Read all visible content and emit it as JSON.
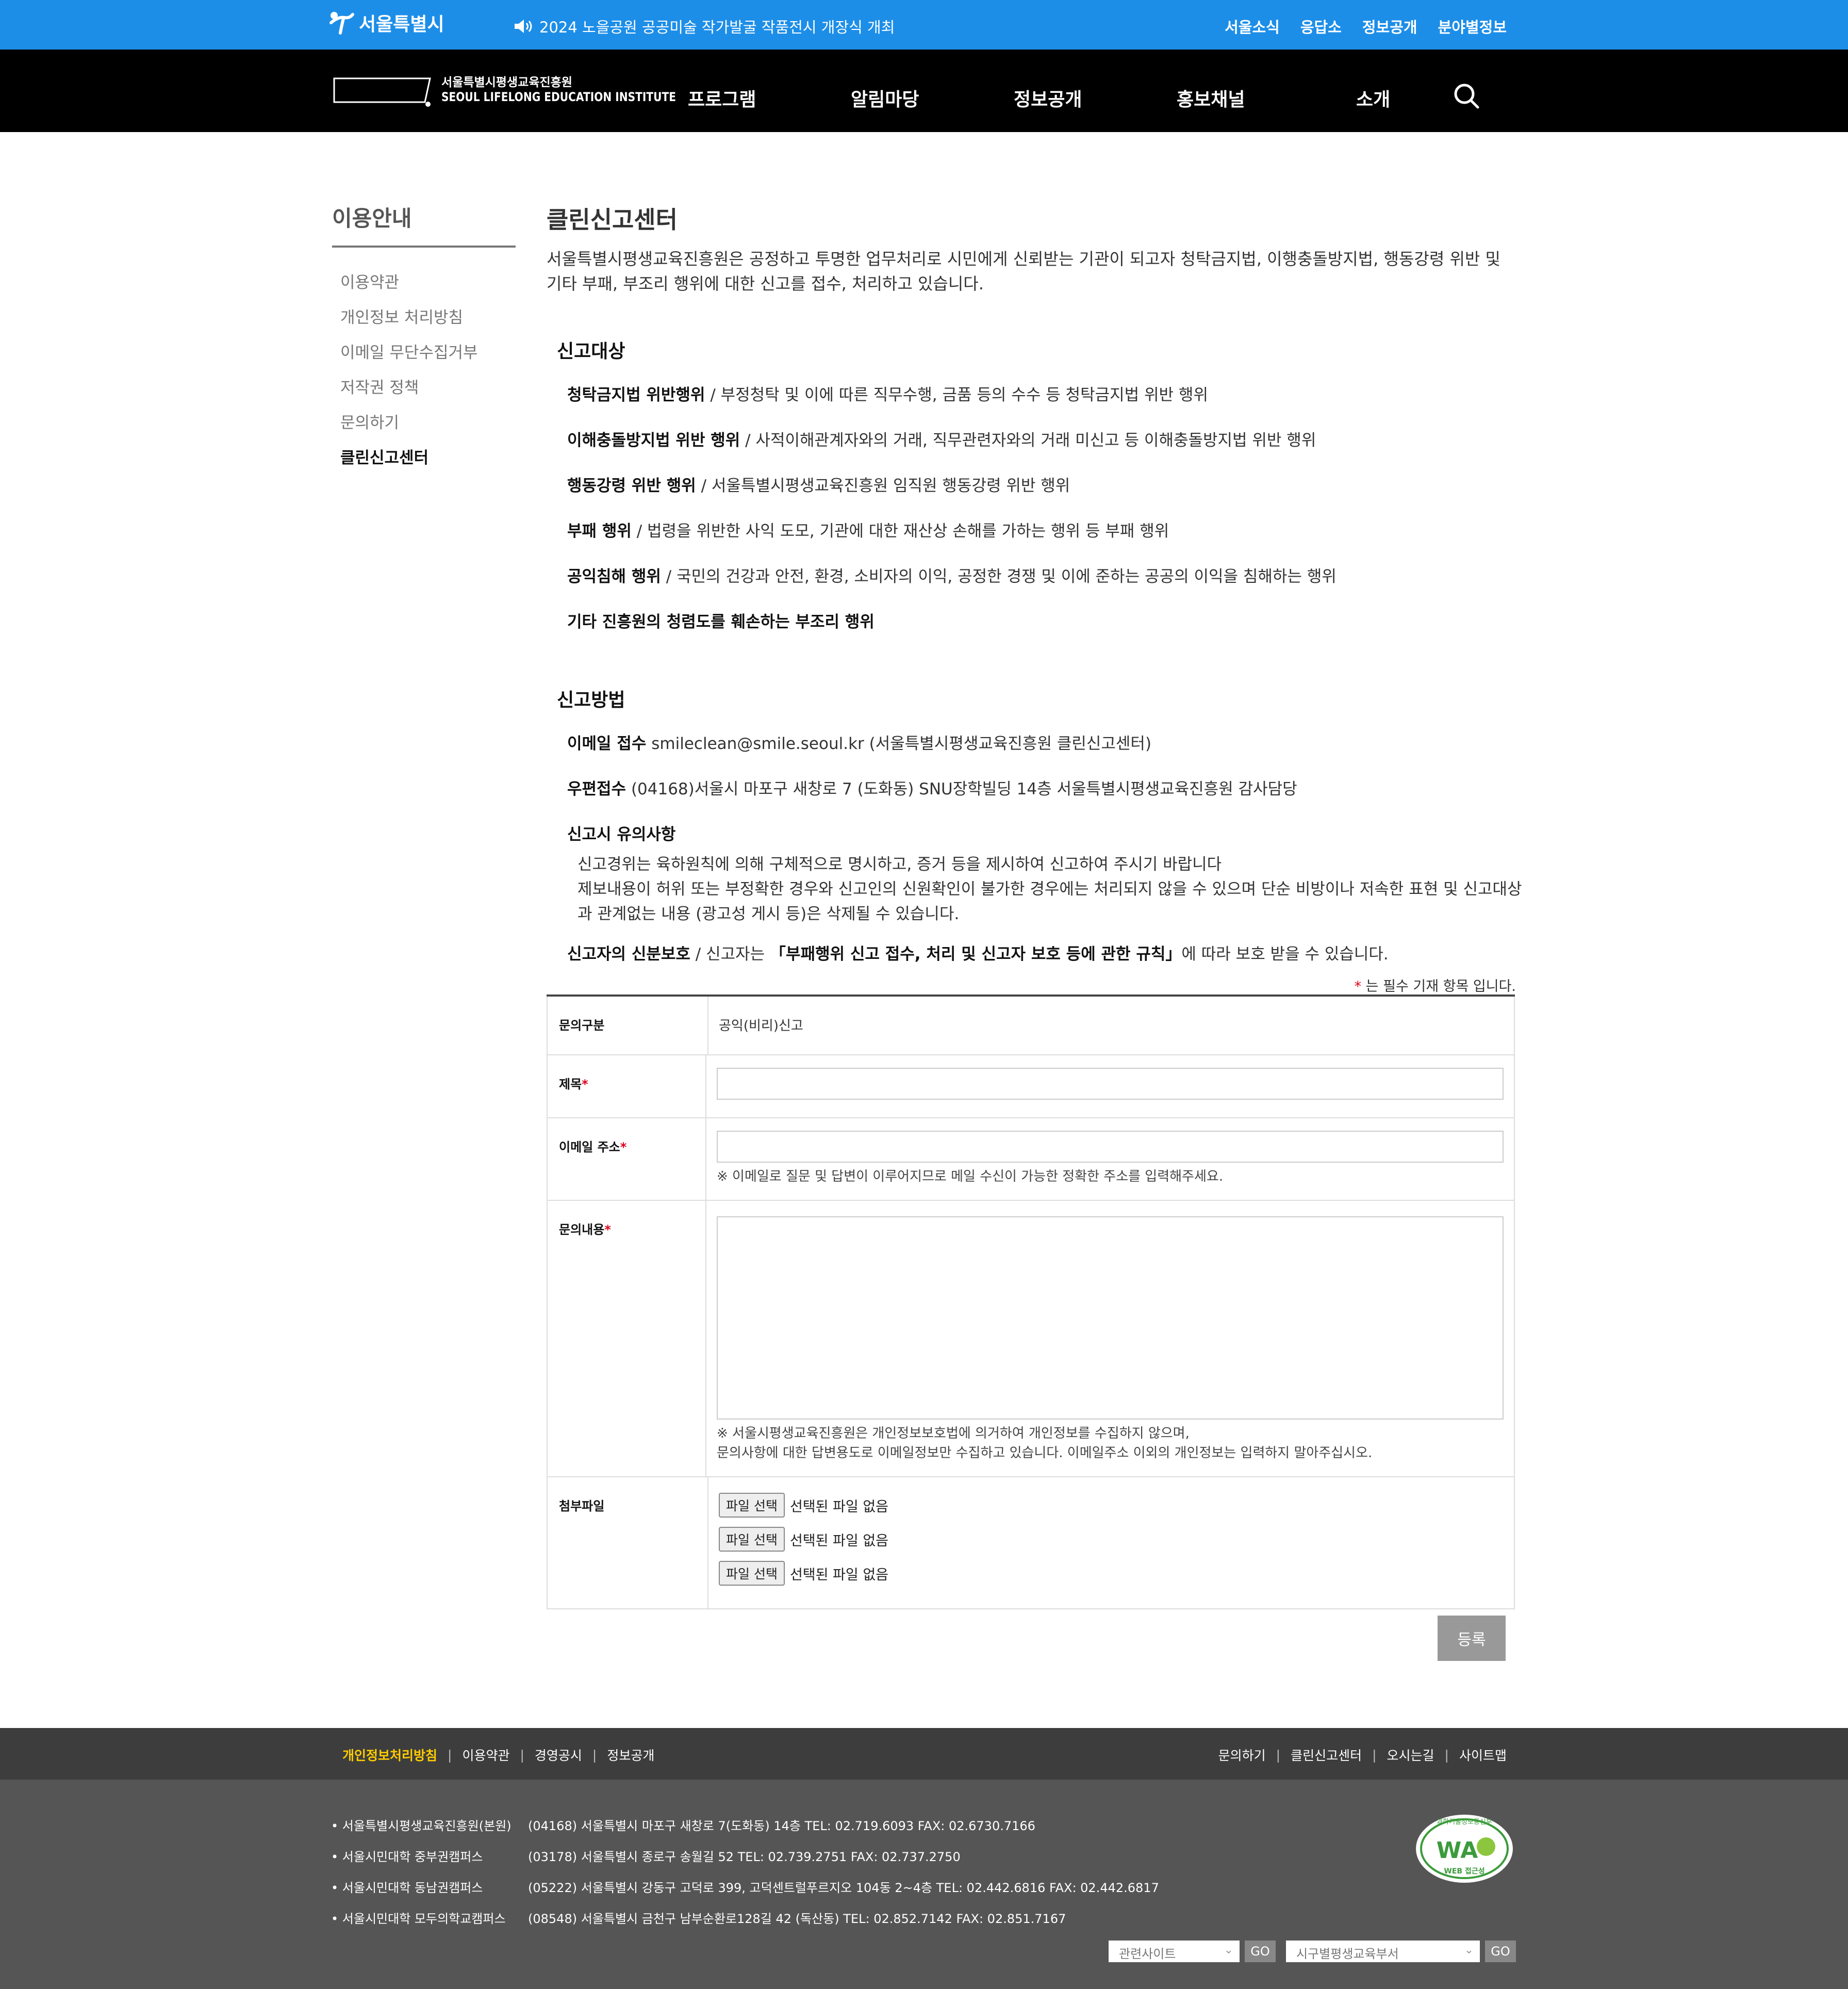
{
  "topbar": {
    "city": "서울특별시",
    "notice": "2024 노을공원 공공미술 작가발굴 작품전시 개장식 개최",
    "links": [
      "서울소식",
      "응답소",
      "정보공개",
      "분야별정보"
    ]
  },
  "nav": {
    "logo_korean": "서울특별시평생교육진흥원",
    "logo_english": "SEOUL LIFELONG EDUCATION INSTITUTE",
    "menu": [
      "프로그램",
      "알림마당",
      "정보공개",
      "홍보채널",
      "소개"
    ],
    "search_icon": "search-icon"
  },
  "sidebar": {
    "title": "이용안내",
    "items": [
      "이용약관",
      "개인정보 처리방침",
      "이메일 무단수집거부",
      "저작권 정책",
      "문의하기",
      "클린신고센터"
    ],
    "active": "클린신고센터"
  },
  "content": {
    "title": "클린신고센터",
    "intro": "서울특별시평생교육진흥원은 공정하고 투명한 업무처리로 시민에게 신뢰받는 기관이 되고자 청탁금지법, 이행충돌방지법, 행동강령 위반 및 기타 부패, 부조리 행위에 대한 신고를 접수, 처리하고 있습니다.",
    "targets_title": "신고대상",
    "targets": [
      {
        "label": "청탁금지법 위반행위",
        "desc": " / 부정청탁 및 이에 따른 직무수행, 금품 등의 수수 등 청탁금지법 위반 행위"
      },
      {
        "label": "이해충돌방지법 위반 행위",
        "desc": " / 사적이해관계자와의 거래, 직무관련자와의 거래 미신고 등 이해충돌방지법 위반 행위"
      },
      {
        "label": "행동강령 위반 행위",
        "desc": " / 서울특별시평생교육진흥원 임직원 행동강령 위반 행위"
      },
      {
        "label": "부패 행위",
        "desc": " / 법령을 위반한 사익 도모, 기관에 대한 재산상 손해를 가하는 행위 등 부패 행위"
      },
      {
        "label": "공익침해 행위",
        "desc": " / 국민의 건강과 안전, 환경, 소비자의 이익, 공정한 경쟁 및 이에 준하는 공공의 이익을 침해하는 행위"
      },
      {
        "label": "기타 진흥원의 청렴도를 훼손하는 부조리 행위",
        "desc": ""
      }
    ],
    "method_title": "신고방법",
    "email_label": "이메일 접수",
    "email_text": " smileclean@smile.seoul.kr (서울특별시평생교육진흥원 클린신고센터)",
    "post_label": "우편접수",
    "post_text": " (04168)서울시 마포구 새창로 7 (도화동) SNU장학빌딩 14층 서울특별시평생교육진흥원 감사담당",
    "caution_title": "신고시 유의사항",
    "caution_1": "신고경위는 육하원칙에 의해 구체적으로 명시하고, 증거 등을 제시하여 신고하여 주시기 바랍니다",
    "caution_2": "제보내용이 허위 또는 부정확한 경우와 신고인의 신원확인이 불가한 경우에는 처리되지 않을 수 있으며 단순 비방이나 저속한 표현 및 신고대상과 관계없는 내용 (광고성 게시 등)은 삭제될 수 있습니다.",
    "protect_label": "신고자의 신분보호",
    "protect_mid": " / 신고자는 ",
    "protect_rule": "「부패행위 신고 접수, 처리 및 신고자 보호 등에 관한 규칙」",
    "protect_end": "에 따라 보호 받을 수 있습니다."
  },
  "form": {
    "required_star": "*",
    "required_note": " 는 필수 기재 항목 입니다.",
    "category_label": "문의구분",
    "category_value": "공익(비리)신고",
    "subject_label": "제목",
    "subject_value": "",
    "email_label": "이메일 주소",
    "email_value": "",
    "email_hint": "※ 이메일로 질문 및 답변이 이루어지므로 메일 수신이 가능한 정확한 주소를 입력해주세요.",
    "content_label": "문의내용",
    "content_value": "",
    "content_hint_1": "※ 서울시평생교육진흥원은 개인정보보호법에 의거하여 개인정보를 수집하지 않으며,",
    "content_hint_2": "문의사항에 대한 답변용도로 이메일정보만 수집하고 있습니다. 이메일주소 이외의 개인정보는 입력하지 말아주십시오.",
    "attach_label": "첨부파일",
    "file_button": "파일 선택",
    "file_none": "선택된 파일 없음",
    "submit": "등록"
  },
  "footer": {
    "left_links": [
      "개인정보처리방침",
      "이용약관",
      "경영공시",
      "정보공개"
    ],
    "right_links": [
      "문의하기",
      "클린신고센터",
      "오시는길",
      "사이트맵"
    ],
    "addresses": [
      {
        "name": "서울특별시평생교육진흥원(본원)",
        "addr": "(04168) 서울특별시 마포구 새창로 7(도화동) 14층 TEL: 02.719.6093 FAX: 02.6730.7166"
      },
      {
        "name": "서울시민대학 중부권캠퍼스",
        "addr": "(03178) 서울특별시 종로구 송월길 52 TEL: 02.739.2751 FAX: 02.737.2750"
      },
      {
        "name": "서울시민대학 동남권캠퍼스",
        "addr": "(05222) 서울특별시 강동구 고덕로 399, 고덕센트럴푸르지오 104동 2~4층 TEL: 02.442.6816 FAX: 02.442.6817"
      },
      {
        "name": "서울시민대학 모두의학교캠퍼스",
        "addr": "(08548) 서울특별시 금천구 남부순환로128길 42 (독산동) TEL: 02.852.7142 FAX: 02.851.7167"
      }
    ],
    "badge_title": "과학기술정보통신부",
    "badge_main": "WA",
    "badge_sub": "WEB 접근성",
    "select_related": "관련사이트",
    "select_district": "시구별평생교육부서",
    "go": "GO"
  }
}
